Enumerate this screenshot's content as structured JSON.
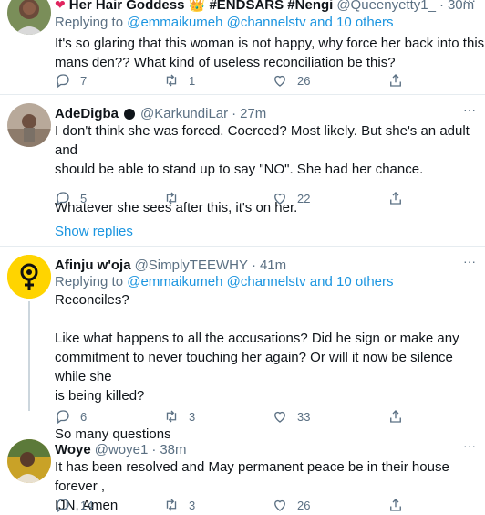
{
  "tweets": [
    {
      "name": "Her Hair Goddess 👑 #ENDSARS #Nengi",
      "handle": "@Queenyetty1_",
      "time": "30m",
      "reply_prefix": "Replying to",
      "mention1": "@emmaikumeh",
      "mention2": "@channelstv",
      "reply_suffix": "and 10 others",
      "text_lines": [
        "It's so glaring that this woman is not happy, why force her back into this",
        "mans den?? What kind of useless reconciliation be this?"
      ],
      "replies": "7",
      "retweets": "1",
      "likes": "26"
    },
    {
      "name": "AdeDigba",
      "handle": "@KarkundiLar",
      "time": "27m",
      "text_lines": [
        "I don't think she was forced. Coerced? Most likely. But she's an adult and",
        "should be able to stand up to say \"NO\". She had her chance.",
        "",
        "Whatever she sees after this, it's on her."
      ],
      "replies": "5",
      "retweets": "",
      "likes": "22"
    },
    {
      "name": "Afinju w'oja",
      "handle": "@SimplyTEEWHY",
      "time": "41m",
      "reply_prefix": "Replying to",
      "mention1": "@emmaikumeh",
      "mention2": "@channelstv",
      "reply_suffix": "and 10 others",
      "text_lines": [
        "Reconciles?",
        "",
        "Like what happens to all the accusations? Did he sign or make any",
        "commitment to never touching her again? Or will it now be silence while she",
        "is being killed?",
        "",
        "So many questions"
      ],
      "replies": "6",
      "retweets": "3",
      "likes": "33"
    },
    {
      "name": "Woye",
      "handle": "@woye1",
      "time": "38m",
      "text_lines": [
        "It has been resolved and May permanent peace be in their house forever ,",
        "IJN, Amen"
      ],
      "replies": "14",
      "retweets": "3",
      "likes": "26"
    }
  ],
  "show_replies": "Show replies",
  "colors": {
    "link": "#1b95e0",
    "muted": "#5b7083",
    "text": "#0f1419",
    "border": "#e6ecf0"
  },
  "icons": [
    "reply-icon",
    "retweet-icon",
    "like-icon",
    "share-icon",
    "more-icon",
    "verified-badge-icon"
  ]
}
